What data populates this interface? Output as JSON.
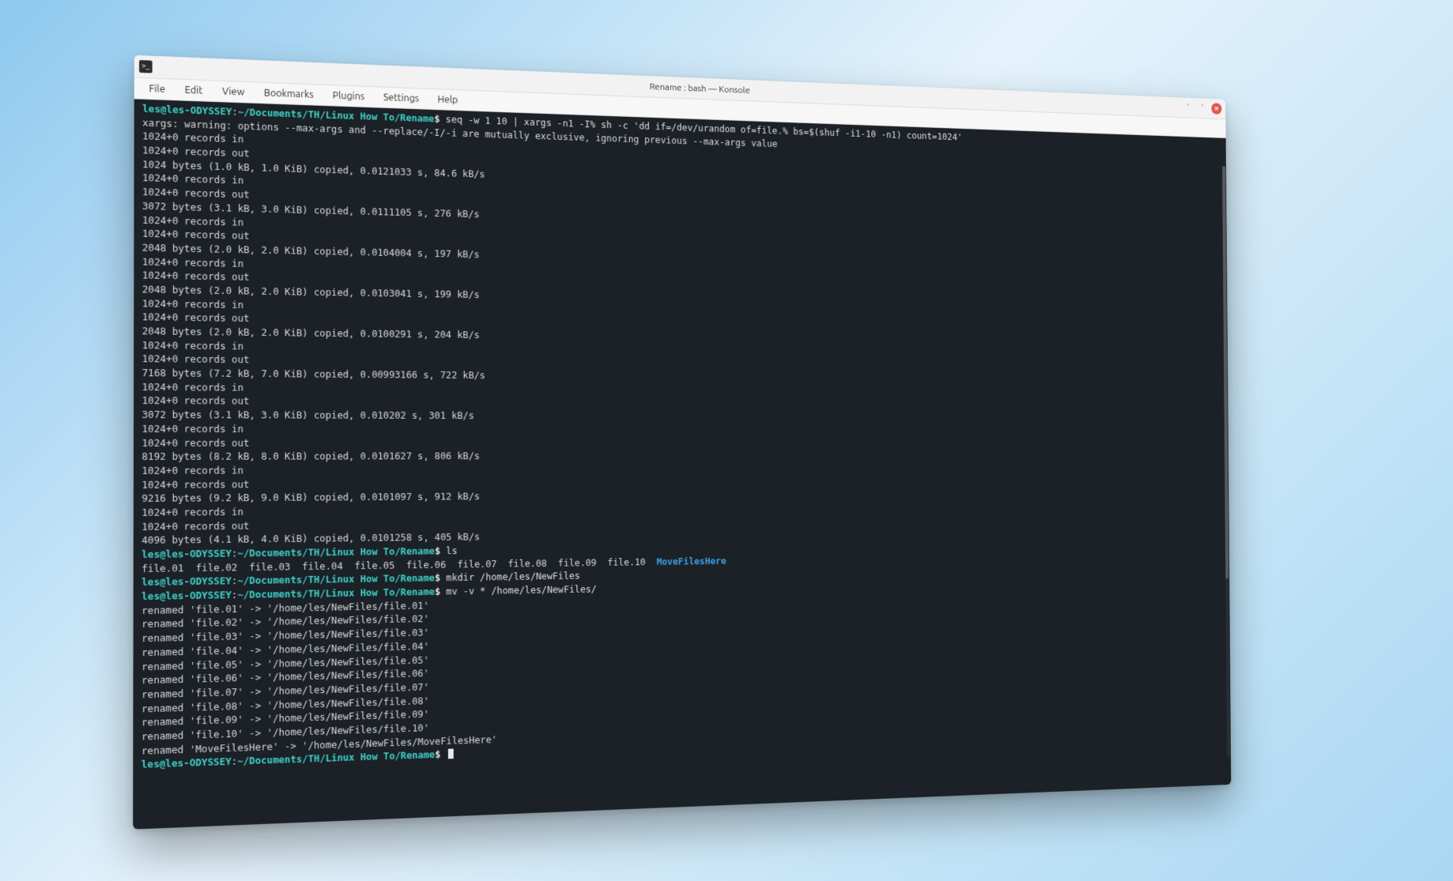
{
  "window": {
    "title": "Rename : bash — Konsole"
  },
  "menu": {
    "file": "File",
    "edit": "Edit",
    "view": "View",
    "bookmarks": "Bookmarks",
    "plugins": "Plugins",
    "settings": "Settings",
    "help": "Help"
  },
  "controls": {
    "minimize": "Minimize",
    "maximize": "Maximize",
    "close": "Close"
  },
  "prompt": {
    "user_host": "les@les-ODYSSEY",
    "path": "~/Documents/TH/Linux How To/Rename",
    "symbol": "$"
  },
  "commands": {
    "seq": "seq -w 1 10 | xargs -n1 -I% sh -c 'dd if=/dev/urandom of=file.% bs=$(shuf -i1-10 -n1) count=1024'",
    "ls": "ls",
    "mkdir": "mkdir /home/les/NewFiles",
    "mv": "mv -v * /home/les/NewFiles/"
  },
  "output": {
    "xargs_warn": "xargs: warning: options --max-args and --replace/-I/-i are mutually exclusive, ignoring previous --max-args value",
    "rec_in": "1024+0 records in",
    "rec_out": "1024+0 records out",
    "dd": [
      "1024 bytes (1.0 kB, 1.0 KiB) copied, 0.0121033 s, 84.6 kB/s",
      "3072 bytes (3.1 kB, 3.0 KiB) copied, 0.0111105 s, 276 kB/s",
      "2048 bytes (2.0 kB, 2.0 KiB) copied, 0.0104004 s, 197 kB/s",
      "2048 bytes (2.0 kB, 2.0 KiB) copied, 0.0103041 s, 199 kB/s",
      "2048 bytes (2.0 kB, 2.0 KiB) copied, 0.0100291 s, 204 kB/s",
      "7168 bytes (7.2 kB, 7.0 KiB) copied, 0.00993166 s, 722 kB/s",
      "3072 bytes (3.1 kB, 3.0 KiB) copied, 0.010202 s, 301 kB/s",
      "8192 bytes (8.2 kB, 8.0 KiB) copied, 0.0101627 s, 806 kB/s",
      "9216 bytes (9.2 kB, 9.0 KiB) copied, 0.0101097 s, 912 kB/s",
      "4096 bytes (4.1 kB, 4.0 KiB) copied, 0.0101258 s, 405 kB/s"
    ],
    "ls_files": {
      "f1": "file.01",
      "f2": "file.02",
      "f3": "file.03",
      "f4": "file.04",
      "f5": "file.05",
      "f6": "file.06",
      "f7": "file.07",
      "f8": "file.08",
      "f9": "file.09",
      "f10": "file.10",
      "dir": "MoveFilesHere"
    },
    "renamed": [
      "renamed 'file.01' -> '/home/les/NewFiles/file.01'",
      "renamed 'file.02' -> '/home/les/NewFiles/file.02'",
      "renamed 'file.03' -> '/home/les/NewFiles/file.03'",
      "renamed 'file.04' -> '/home/les/NewFiles/file.04'",
      "renamed 'file.05' -> '/home/les/NewFiles/file.05'",
      "renamed 'file.06' -> '/home/les/NewFiles/file.06'",
      "renamed 'file.07' -> '/home/les/NewFiles/file.07'",
      "renamed 'file.08' -> '/home/les/NewFiles/file.08'",
      "renamed 'file.09' -> '/home/les/NewFiles/file.09'",
      "renamed 'file.10' -> '/home/les/NewFiles/file.10'",
      "renamed 'MoveFilesHere' -> '/home/les/NewFiles/MoveFilesHere'"
    ]
  }
}
